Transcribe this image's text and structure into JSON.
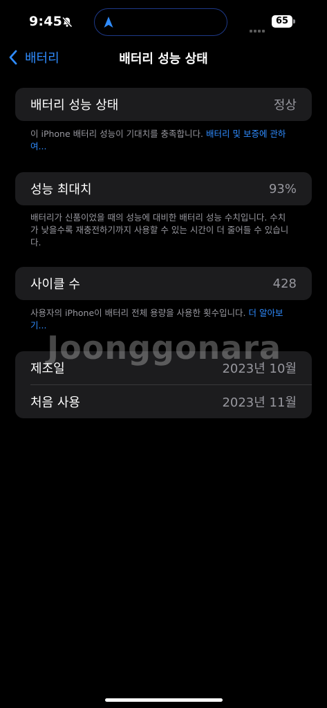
{
  "status_bar": {
    "time": "9:45",
    "battery_level": "65"
  },
  "nav": {
    "back_label": "배터리",
    "title": "배터리 성능 상태"
  },
  "health_section": {
    "row_label": "배터리 성능 상태",
    "row_value": "정상",
    "footnote_text": "이 iPhone 배터리 성능이 기대치를 충족합니다. ",
    "footnote_link": "배터리 및 보증에 관하여..."
  },
  "capacity_section": {
    "row_label": "성능 최대치",
    "row_value": "93%",
    "footnote_text": "배터리가 신품이었을 때의 성능에 대비한 배터리 성능 수치입니다. 수치가 낮을수록 재충전하기까지 사용할 수 있는 시간이 더 줄어들 수 있습니다."
  },
  "cycle_section": {
    "row_label": "사이클 수",
    "row_value": "428",
    "footnote_text": "사용자의 iPhone이 배터리 전체 용량을 사용한 횟수입니다. ",
    "footnote_link": "더 알아보기..."
  },
  "dates_section": {
    "manufacture_label": "제조일",
    "manufacture_value": "2023년 10월",
    "first_use_label": "처음 사용",
    "first_use_value": "2023년 11월"
  },
  "watermark": "Joonggonara"
}
